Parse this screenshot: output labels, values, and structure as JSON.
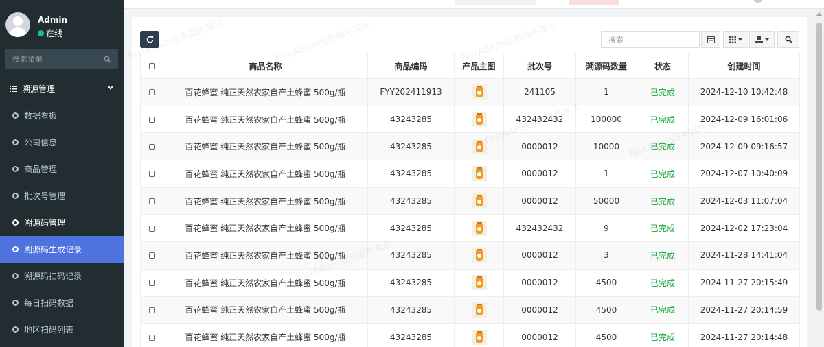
{
  "user": {
    "name": "Admin",
    "status": "在线"
  },
  "sidebar": {
    "search_placeholder": "搜索菜单",
    "section": "溯源管理",
    "items": [
      {
        "label": "数据看板"
      },
      {
        "label": "公司信息"
      },
      {
        "label": "商品管理"
      },
      {
        "label": "批次号管理"
      },
      {
        "label": "溯源码管理"
      },
      {
        "label": "溯源码生成记录"
      },
      {
        "label": "溯源码扫码记录"
      },
      {
        "label": "每日扫码数据"
      },
      {
        "label": "地区扫码列表"
      }
    ]
  },
  "toolbar": {
    "search_placeholder": "搜索"
  },
  "table": {
    "headers": [
      "商品名称",
      "商品编码",
      "产品主图",
      "批次号",
      "溯源码数量",
      "状态",
      "创建时间"
    ],
    "rows": [
      {
        "name": "百花蜂蜜 纯正天然农家自产土蜂蜜 500g/瓶",
        "code": "FYY202411913",
        "batch": "241105",
        "qty": "1",
        "status": "已完成",
        "time": "2024-12-10 10:42:48"
      },
      {
        "name": "百花蜂蜜 纯正天然农家自产土蜂蜜 500g/瓶",
        "code": "43243285",
        "batch": "432432432",
        "qty": "100000",
        "status": "已完成",
        "time": "2024-12-09 16:01:06"
      },
      {
        "name": "百花蜂蜜 纯正天然农家自产土蜂蜜 500g/瓶",
        "code": "43243285",
        "batch": "0000012",
        "qty": "10000",
        "status": "已完成",
        "time": "2024-12-09 09:16:57"
      },
      {
        "name": "百花蜂蜜 纯正天然农家自产土蜂蜜 500g/瓶",
        "code": "43243285",
        "batch": "0000012",
        "qty": "1",
        "status": "已完成",
        "time": "2024-12-07 10:40:09"
      },
      {
        "name": "百花蜂蜜 纯正天然农家自产土蜂蜜 500g/瓶",
        "code": "43243285",
        "batch": "0000012",
        "qty": "50000",
        "status": "已完成",
        "time": "2024-12-03 11:07:04"
      },
      {
        "name": "百花蜂蜜 纯正天然农家自产土蜂蜜 500g/瓶",
        "code": "43243285",
        "batch": "432432432",
        "qty": "9",
        "status": "已完成",
        "time": "2024-12-02 17:23:04"
      },
      {
        "name": "百花蜂蜜 纯正天然农家自产土蜂蜜 500g/瓶",
        "code": "43243285",
        "batch": "0000012",
        "qty": "3",
        "status": "已完成",
        "time": "2024-11-28 14:41:04"
      },
      {
        "name": "百花蜂蜜 纯正天然农家自产土蜂蜜 500g/瓶",
        "code": "43243285",
        "batch": "0000012",
        "qty": "4500",
        "status": "已完成",
        "time": "2024-11-27 20:15:49"
      },
      {
        "name": "百花蜂蜜 纯正天然农家自产土蜂蜜 500g/瓶",
        "code": "43243285",
        "batch": "0000012",
        "qty": "4500",
        "status": "已完成",
        "time": "2024-11-27 20:14:59"
      },
      {
        "name": "百花蜂蜜 纯正天然农家自产土蜂蜜 500g/瓶",
        "code": "43243285",
        "batch": "0000012",
        "qty": "4500",
        "status": "已完成",
        "time": "2024-11-27 20:14:48"
      }
    ]
  },
  "watermark": "FastAdmin应用插件演示",
  "colors": {
    "sidebar_bg": "#222d32",
    "active_menu": "#4e73df",
    "status_green": "#18a73a",
    "online_dot": "#18bc9c"
  }
}
